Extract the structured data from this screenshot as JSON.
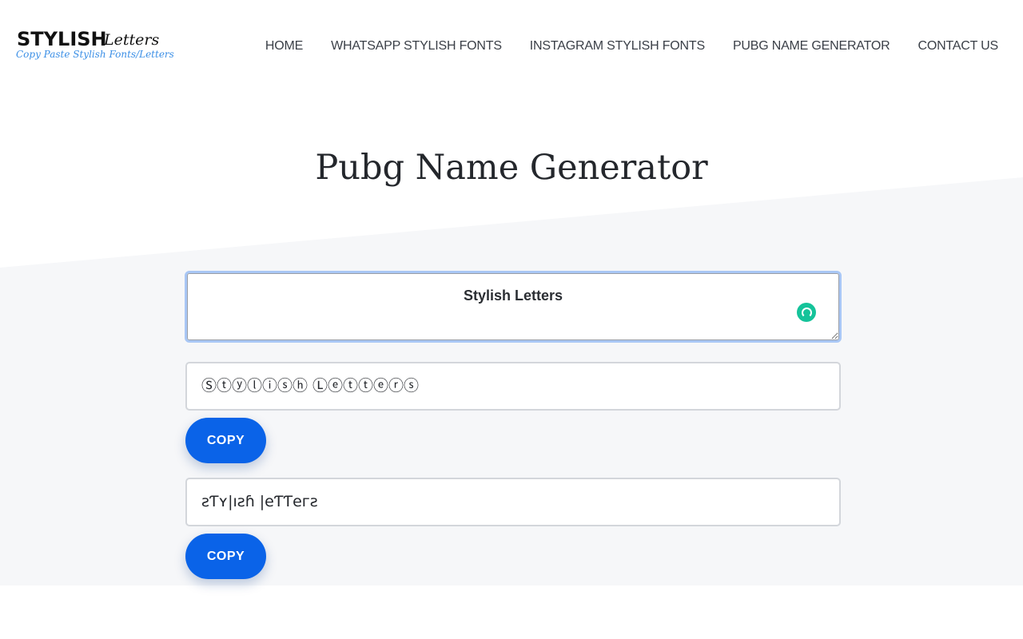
{
  "logo": {
    "main": "STYLISH",
    "script": "Letters",
    "tagline": "Copy Paste Stylish Fonts/Letters"
  },
  "nav": {
    "items": [
      {
        "label": "HOME"
      },
      {
        "label": "WHATSAPP STYLISH FONTS"
      },
      {
        "label": "INSTAGRAM STYLISH FONTS"
      },
      {
        "label": "PUBG NAME GENERATOR"
      },
      {
        "label": "CONTACT US"
      }
    ]
  },
  "page": {
    "title": "Pubg Name Generator"
  },
  "input": {
    "value": "Stylish Letters"
  },
  "results": [
    {
      "text": "Ⓢⓣⓨⓛⓘⓢⓗ Ⓛⓔⓣⓣⓔⓡⓢ",
      "copy_label": "COPY"
    },
    {
      "text": "ƨƬʏ|ıƨɦ |eƬƬeгƨ",
      "copy_label": "COPY"
    }
  ],
  "colors": {
    "accent": "#0a63e8",
    "hero_background": "#f6f7f9",
    "grammar_icon": "#15c39a",
    "tagline": "#3b8fe6"
  }
}
